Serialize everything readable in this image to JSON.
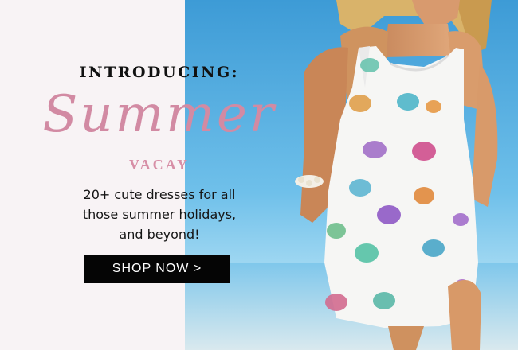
{
  "hero": {
    "intro": "INTRODUCING:",
    "title": "Summer",
    "subtitle": "VACAY",
    "tagline_lines": [
      "20+ cute dresses for all",
      "those summer holidays,",
      "and beyond!"
    ],
    "cta_label": "SHOP NOW >"
  },
  "colors": {
    "panel_bg": "#f8f3f5",
    "script_pink": "#d28aa3",
    "button_bg": "#050505",
    "sky": "#3aa0d9",
    "sea": "#5bb3e3"
  },
  "image": {
    "subject": "woman in white sundress with turtle print on beach",
    "icon": "photo-icon"
  }
}
